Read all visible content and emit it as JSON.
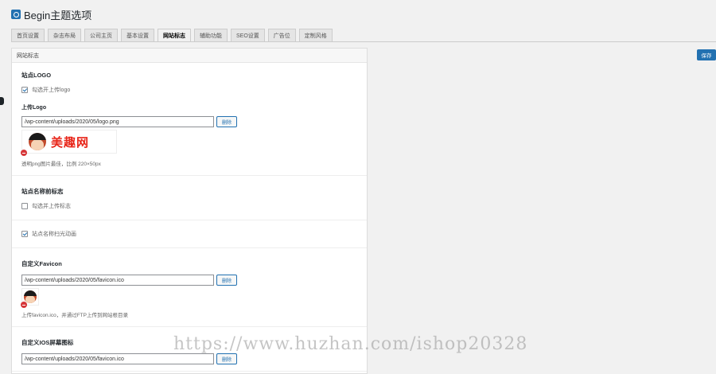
{
  "header": {
    "title": "Begin主题选项"
  },
  "tabs": [
    "首页设置",
    "杂志布局",
    "公司主页",
    "基本设置",
    "网站标志",
    "辅助功能",
    "SEO设置",
    "广告位",
    "定制风格"
  ],
  "active_tab": 4,
  "save_label": "保存",
  "panel": {
    "header": "网站标志"
  },
  "logo_section": {
    "title": "站点LOGO",
    "enable_label": "勾选开上传logo",
    "upload_title": "上传Logo",
    "url": "/wp-content/uploads/2020/05/logo.png",
    "delete_label": "删除",
    "preview_text": "美趣网",
    "desc": "透明png图片最佳，比例 220×50px"
  },
  "name_section": {
    "title": "站点名称前标志",
    "option_label": "勾选并上传标志"
  },
  "sweep_section": {
    "option_label": "站点名称扫光动画"
  },
  "favicon_section": {
    "title": "自定义Favicon",
    "url": "/wp-content/uploads/2020/05/favicon.ico",
    "delete_label": "删除",
    "desc": "上传favicon.ico，并通过FTP上传到网站根目录"
  },
  "ios_section": {
    "title": "自定义IOS屏幕图标",
    "url": "/wp-content/uploads/2020/05/favicon.ico",
    "delete_label": "删除"
  },
  "watermark": "https://www.huzhan.com/ishop20328",
  "colors": {
    "accent": "#2271b1",
    "delete_red": "#d63638",
    "logo_red": "#e8261a"
  }
}
